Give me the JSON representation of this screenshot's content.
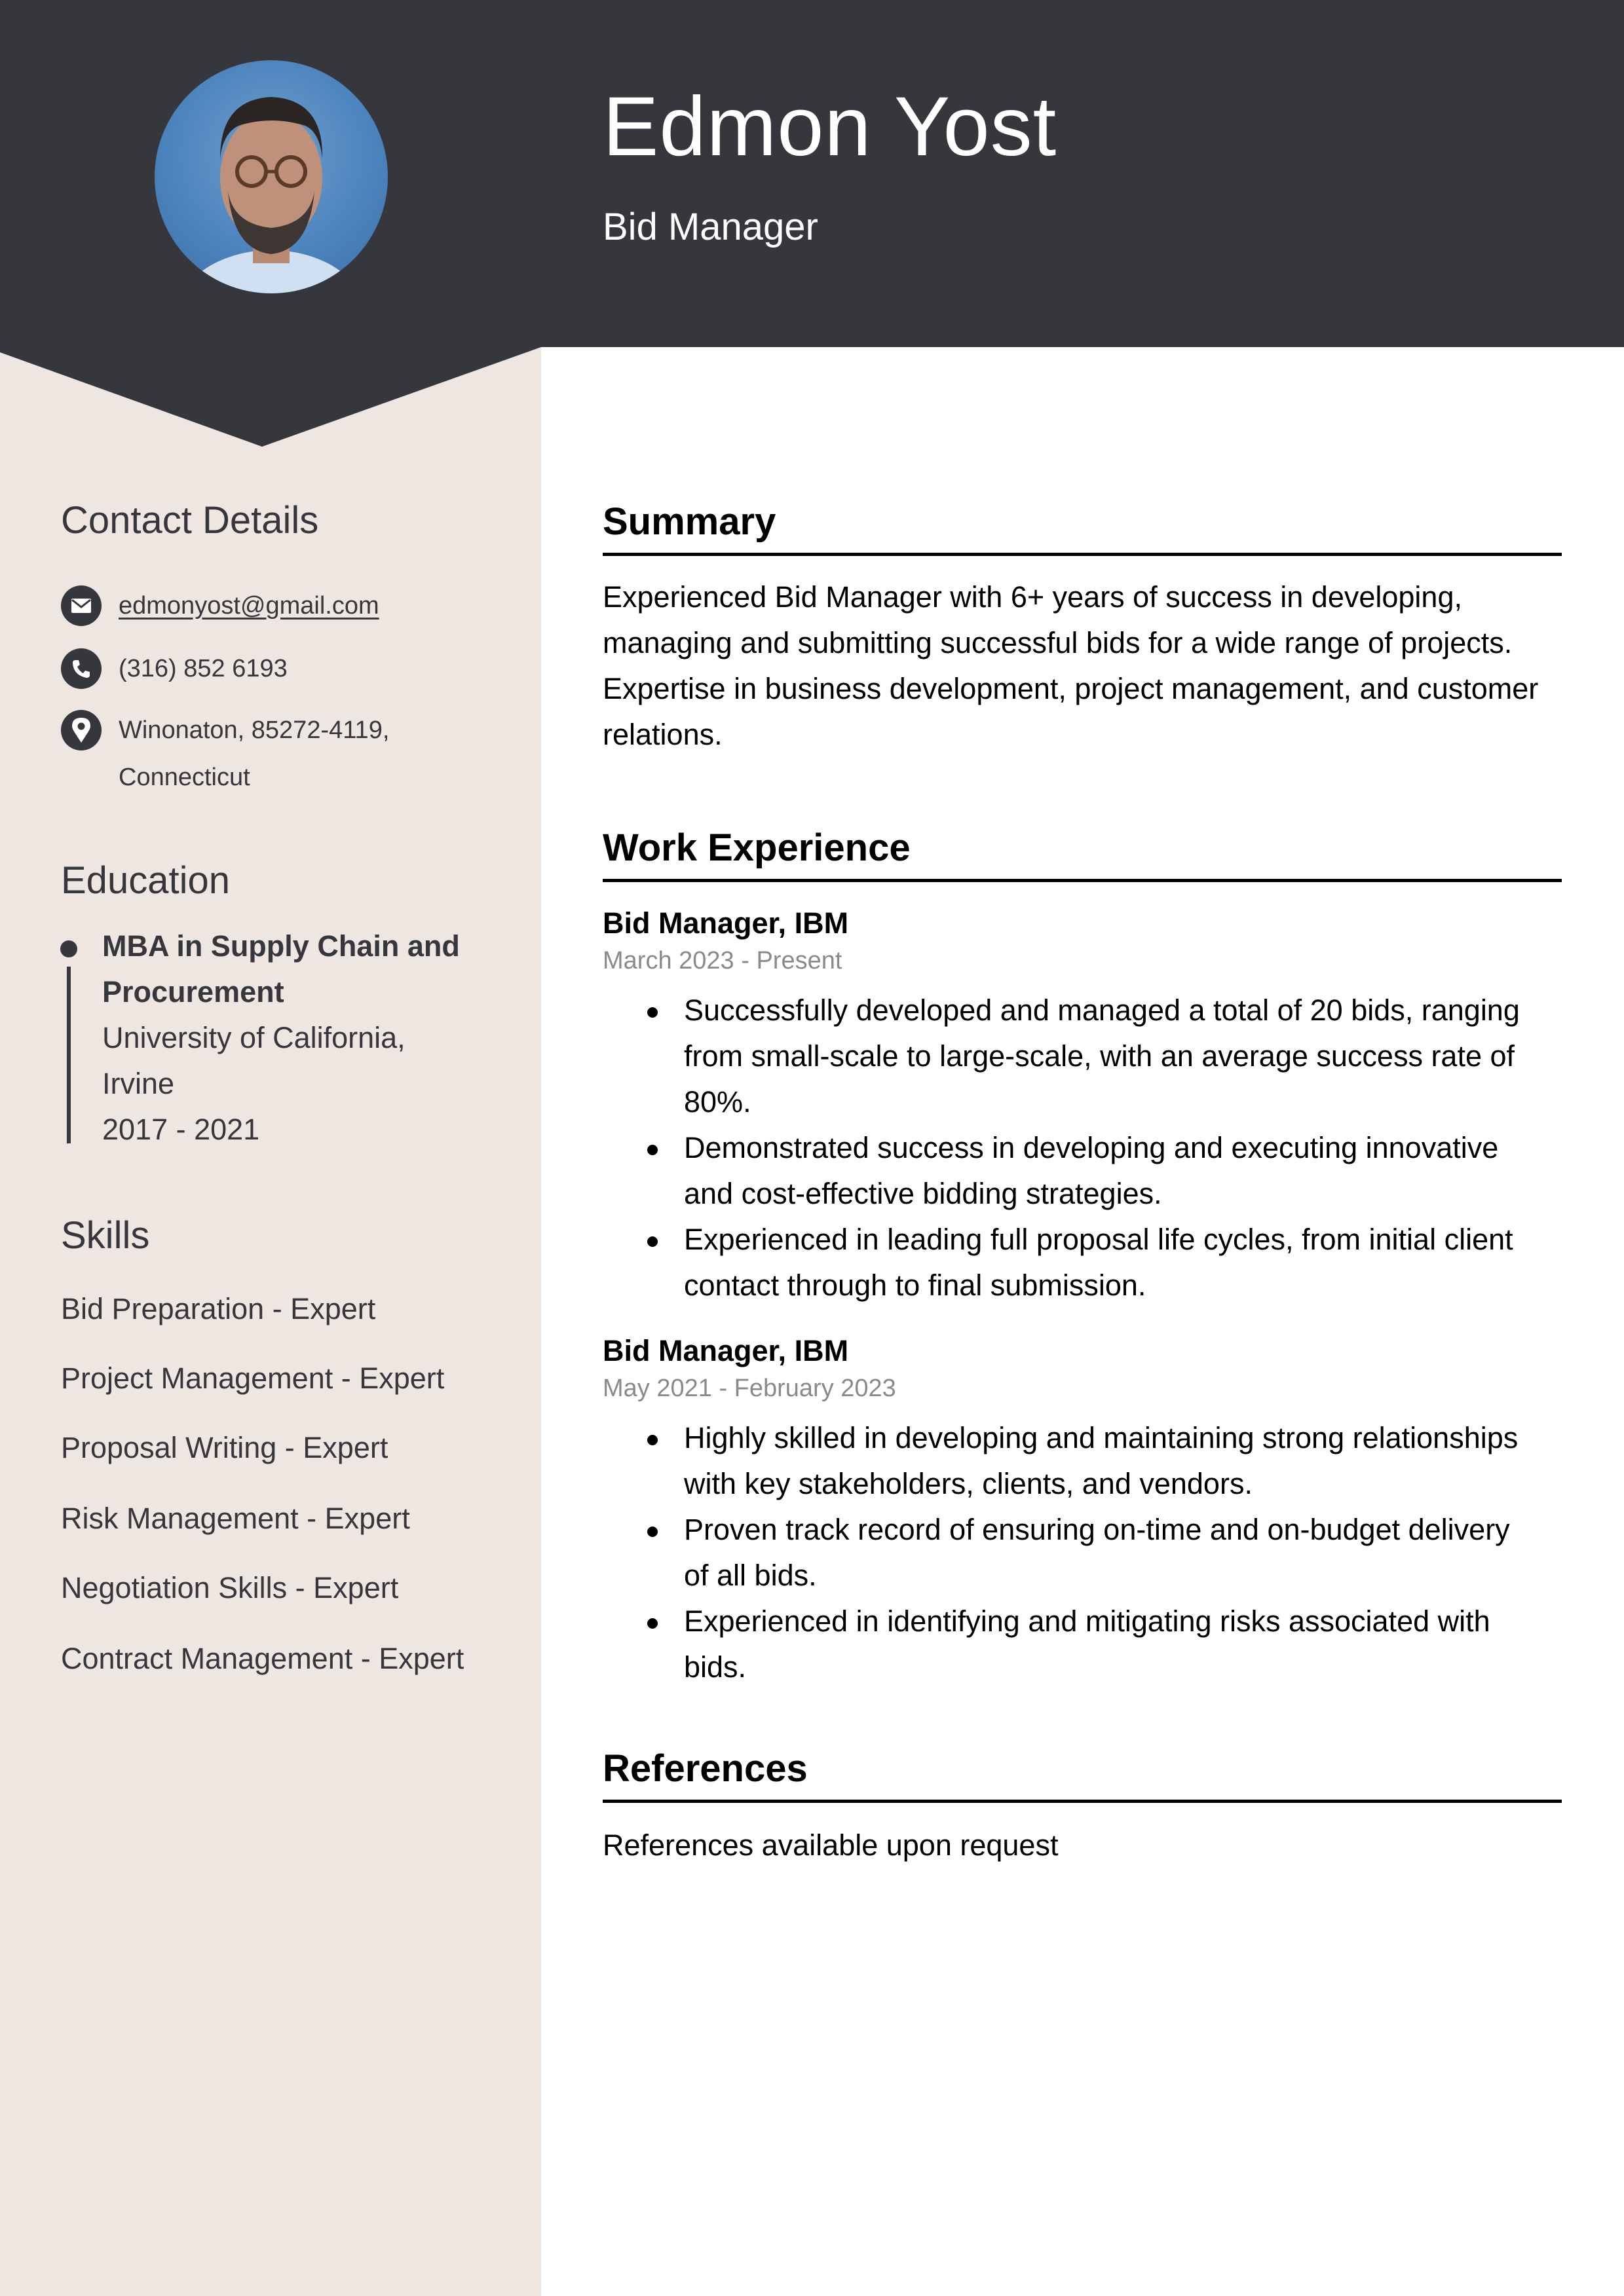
{
  "header": {
    "name": "Edmon Yost",
    "title": "Bid Manager",
    "photo_alt": "Profile photo of Edmon Yost"
  },
  "colors": {
    "header_bg": "#36373d",
    "sidebar_bg": "#ede6e1",
    "text_dark": "#36373d",
    "date_gray": "#8a8a8a"
  },
  "sidebar": {
    "contact": {
      "heading": "Contact Details",
      "items": [
        {
          "icon": "envelope-icon",
          "text": "edmonyost@gmail.com"
        },
        {
          "icon": "phone-icon",
          "text": "(316) 852 6193"
        },
        {
          "icon": "location-pin-icon",
          "line1": "Winonaton, 85272-4119,",
          "line2": "Connecticut"
        }
      ]
    },
    "education": {
      "heading": "Education",
      "items": [
        {
          "degree_line1": "MBA in Supply Chain and",
          "degree_line2": "Procurement",
          "school_line1": "University of California,",
          "school_line2": "Irvine",
          "years": "2017 - 2021"
        }
      ]
    },
    "skills": {
      "heading": "Skills",
      "items": [
        "Bid Preparation - Expert",
        "Project Management - Expert",
        "Proposal Writing - Expert",
        "Risk Management - Expert",
        "Negotiation Skills - Expert",
        "Contract Management - Expert"
      ]
    }
  },
  "main": {
    "summary": {
      "heading": "Summary",
      "lines": [
        "Experienced Bid Manager with 6+ years of success in developing,",
        "managing and submitting successful bids for a wide range of projects.",
        "Expertise in business development, project management, and customer",
        "relations."
      ]
    },
    "experience": {
      "heading": "Work Experience",
      "jobs": [
        {
          "title": "Bid Manager, IBM",
          "dates": "March 2023 - Present",
          "bullets": [
            "Successfully developed and managed a total of 20 bids, ranging from small-scale to large-scale, with an average success rate of 80%.",
            "Demonstrated success in developing and executing innovative and cost-effective bidding strategies.",
            "Experienced in leading full proposal life cycles, from initial client contact through to final submission."
          ]
        },
        {
          "title": "Bid Manager, IBM",
          "dates": "May 2021 - February 2023",
          "bullets": [
            "Highly skilled in developing and maintaining strong relationships with key stakeholders, clients, and vendors.",
            "Proven track record of ensuring on-time and on-budget delivery of all bids.",
            "Experienced in identifying and mitigating risks associated with bids."
          ]
        }
      ]
    },
    "references": {
      "heading": "References",
      "text": "References available upon request"
    }
  }
}
